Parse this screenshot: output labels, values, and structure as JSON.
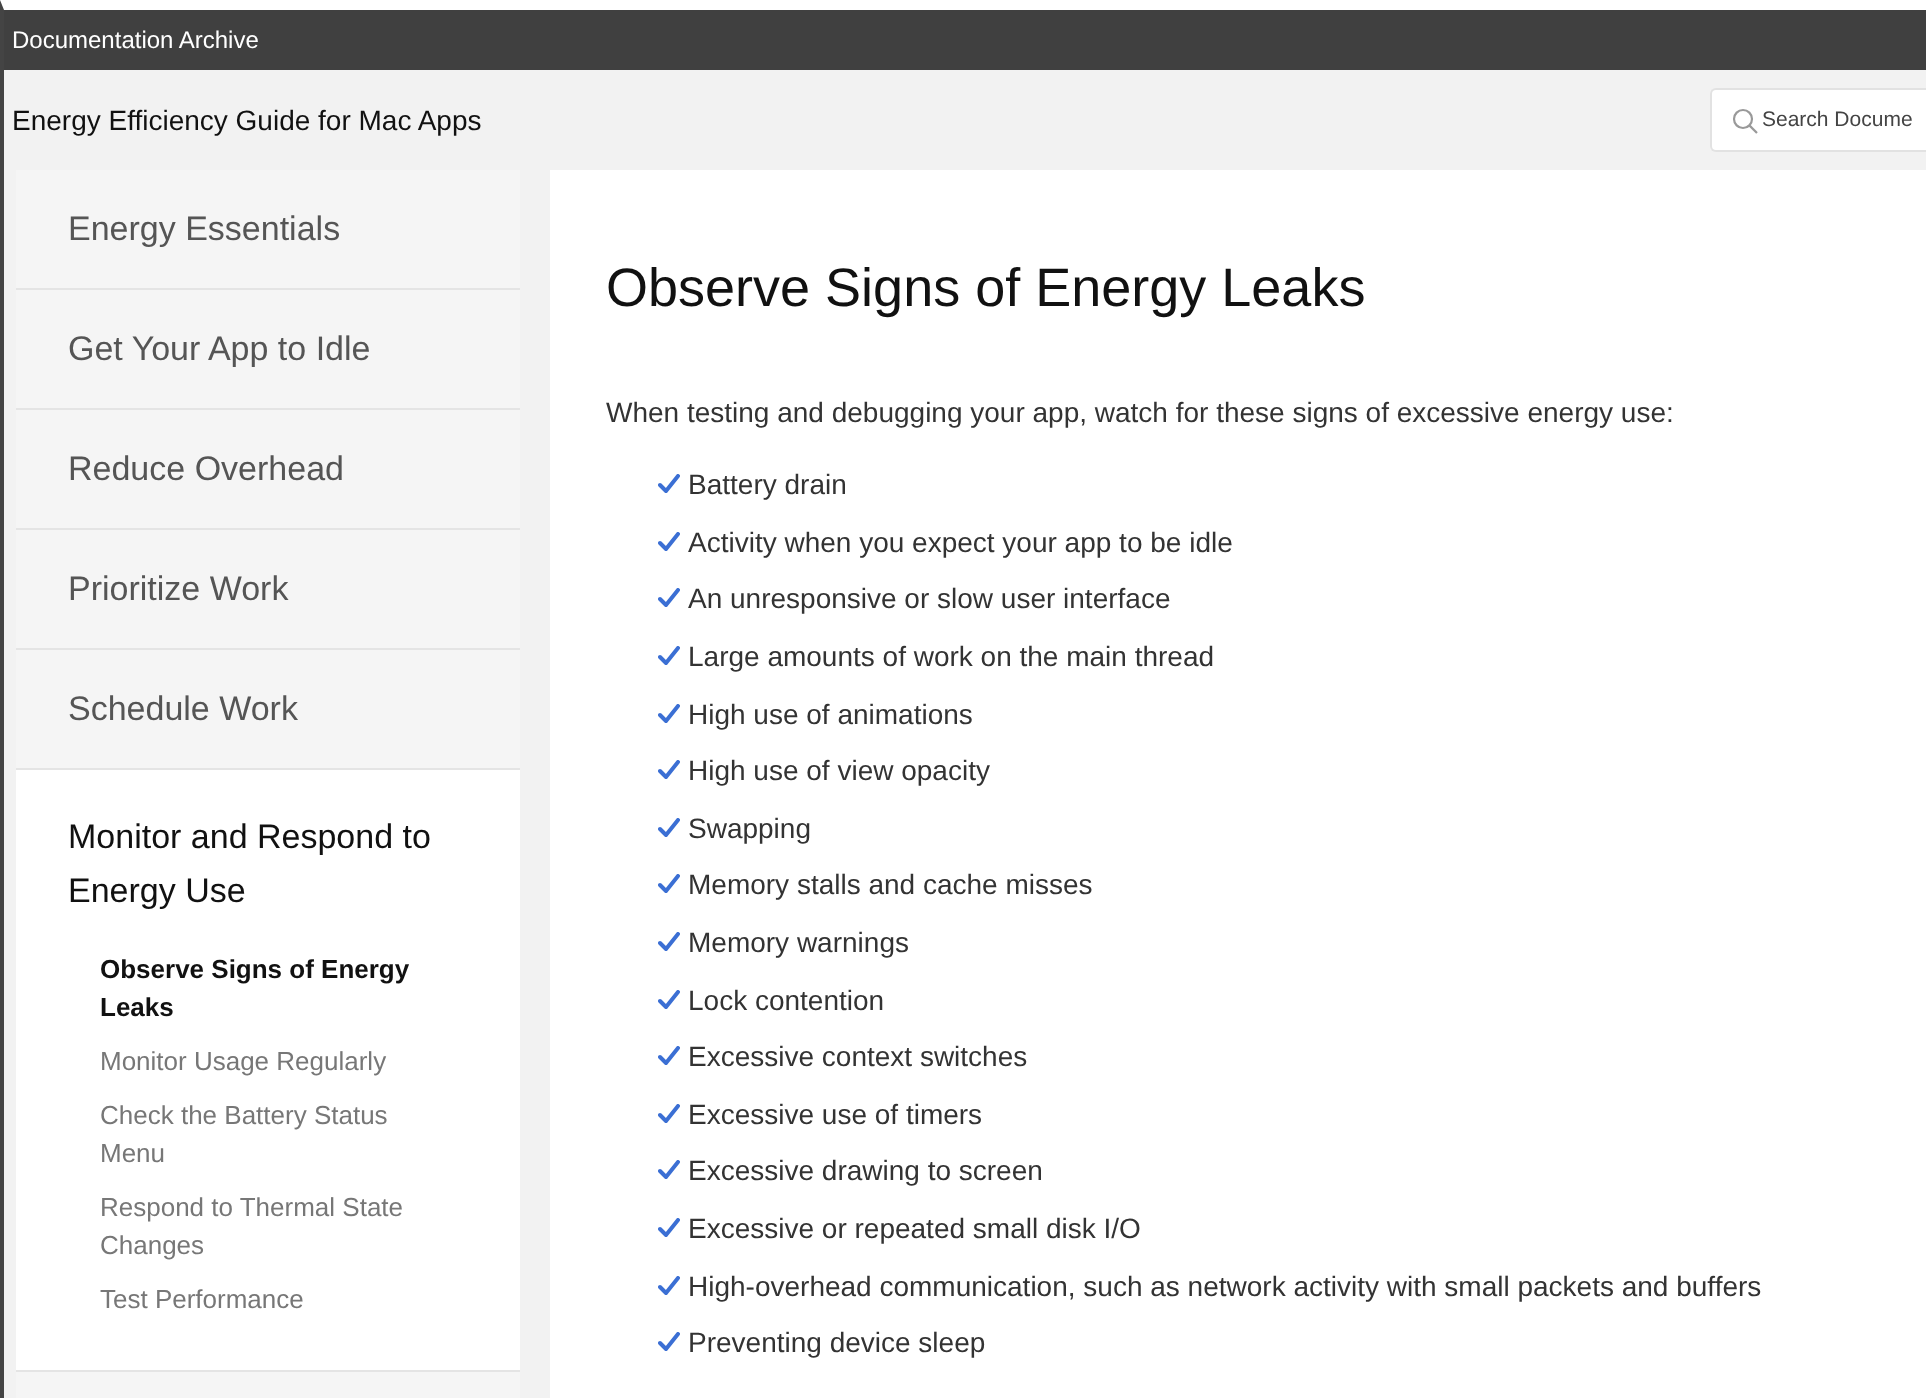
{
  "window": {
    "title": "Documentation Archive"
  },
  "header": {
    "title": "Energy Efficiency Guide for Mac Apps",
    "search": {
      "placeholder": "Search Docume"
    }
  },
  "sidebar": {
    "items": [
      {
        "label": "Energy Essentials",
        "expanded": false
      },
      {
        "label": "Get Your App to Idle",
        "expanded": false
      },
      {
        "label": "Reduce Overhead",
        "expanded": false
      },
      {
        "label": "Prioritize Work",
        "expanded": false
      },
      {
        "label": "Schedule Work",
        "expanded": false
      },
      {
        "label": "Monitor and Respond to Energy Use",
        "expanded": true,
        "children": [
          {
            "label": "Observe Signs of Energy Leaks",
            "selected": true
          },
          {
            "label": "Monitor Usage Regularly",
            "selected": false
          },
          {
            "label": "Check the Battery Status Menu",
            "selected": false
          },
          {
            "label": "Respond to Thermal State Changes",
            "selected": false
          },
          {
            "label": "Test Performance",
            "selected": false
          }
        ]
      }
    ]
  },
  "article": {
    "heading": "Observe Signs of Energy Leaks",
    "intro": "When testing and debugging your app, watch for these signs of excessive energy use:",
    "signs": [
      "Battery drain",
      "Activity when you expect your app to be idle",
      "An unresponsive or slow user interface",
      "Large amounts of work on the main thread",
      "High use of animations",
      "High use of view opacity",
      "Swapping",
      "Memory stalls and cache misses",
      "Memory warnings",
      "Lock contention",
      "Excessive context switches",
      "Excessive use of timers",
      "Excessive drawing to screen",
      "Excessive or repeated small disk I/O",
      "High-overhead communication, such as network activity with small packets and buffers",
      "Preventing device sleep"
    ]
  }
}
